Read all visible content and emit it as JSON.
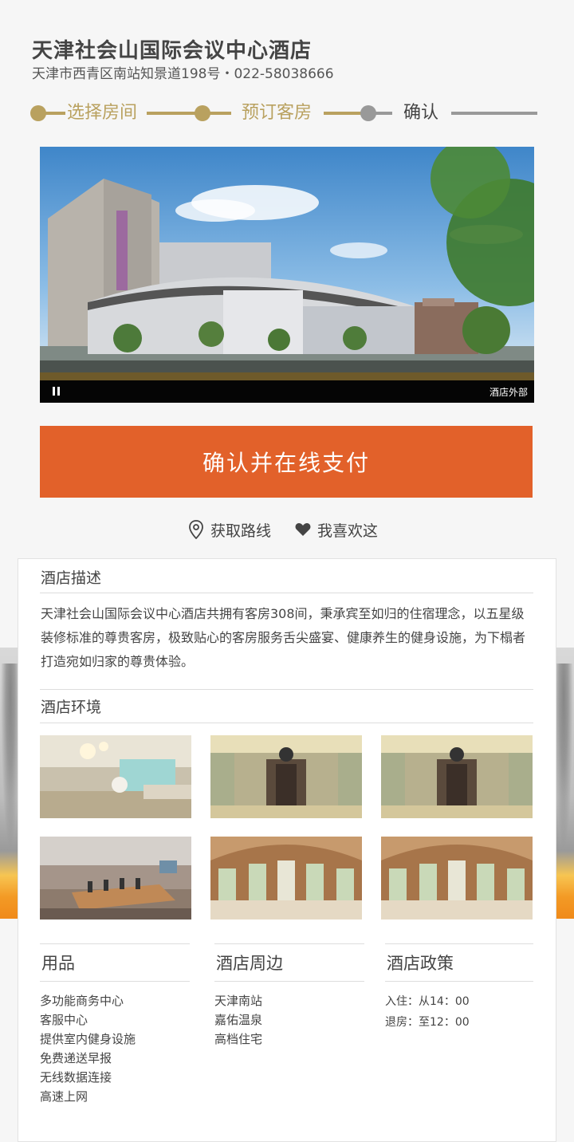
{
  "hotel": {
    "name": "天津社会山国际会议中心酒店",
    "address": "天津市西青区南站知景道198号・022-58038666"
  },
  "steps": [
    {
      "label": "选择房间",
      "state": "done"
    },
    {
      "label": "预订客房",
      "state": "done"
    },
    {
      "label": "确认",
      "state": "current"
    }
  ],
  "hero": {
    "caption": "酒店外部"
  },
  "pay_button": "确认并在线支付",
  "actions": {
    "route": "获取路线",
    "like": "我喜欢这"
  },
  "description": {
    "title": "酒店描述",
    "text": "天津社会山国际会议中心酒店共拥有客房308间，秉承宾至如归的住宿理念，以五星级装修标准的尊贵客房，极致贴心的客房服务舌尖盛宴、健康养生的健身设施，为下榻者打造宛如归家的尊贵体验。"
  },
  "environment": {
    "title": "酒店环境",
    "photos": [
      "lobby",
      "elevator-hall",
      "elevator-hall",
      "meeting-room",
      "restaurant",
      "restaurant"
    ]
  },
  "amenities": {
    "title": "用品",
    "items": [
      "多功能商务中心",
      "客服中心",
      "提供室内健身设施",
      "免费递送早报",
      "无线数据连接",
      "高速上网"
    ]
  },
  "nearby": {
    "title": "酒店周边",
    "items": [
      "天津南站",
      "嘉佑温泉",
      "高档住宅"
    ]
  },
  "policy": {
    "title": "酒店政策",
    "checkin": "入住：从14：00",
    "checkout": "退房：至12：00"
  },
  "colors": {
    "accent": "#b9a15f",
    "pay": "#e2612a",
    "inactive": "#999999"
  }
}
